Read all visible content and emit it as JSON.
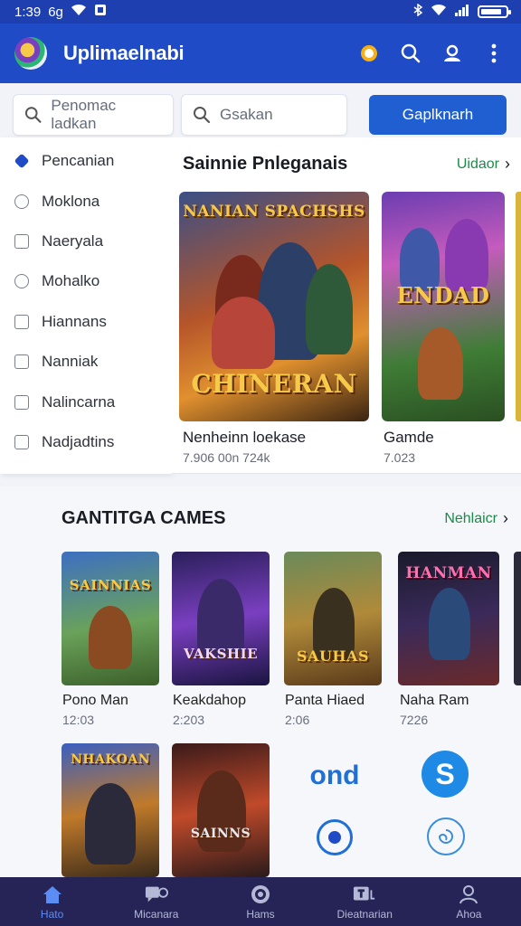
{
  "status_bar": {
    "time": "1:39",
    "extra": "6g"
  },
  "app_bar": {
    "title": "Uplimaelnabi"
  },
  "search": {
    "field1_placeholder": "Penomac ladkan",
    "field2_placeholder": "Gsakan",
    "button_label": "Gaplknarh"
  },
  "side_menu": {
    "items": [
      {
        "label": "Pencanian",
        "icon": "diamond-icon"
      },
      {
        "label": "Moklona",
        "icon": "tag-icon"
      },
      {
        "label": "Naeryala",
        "icon": "box-icon"
      },
      {
        "label": "Mohalko",
        "icon": "emoji-icon"
      },
      {
        "label": "Hiannans",
        "icon": "square-icon"
      },
      {
        "label": "Nanniak",
        "icon": "square-icon"
      },
      {
        "label": "Nalincarna",
        "icon": "square-icon"
      },
      {
        "label": "Nadjadtins",
        "icon": "square-icon"
      }
    ]
  },
  "featured": {
    "title": "Sainnie Pnleganais",
    "link": "Uidaor",
    "cards": [
      {
        "cover_title_top": "NANIAN SPACHSHS",
        "cover_title": "CHINERAN",
        "name": "Nenheinn loekase",
        "meta": "7.906 00n 724k"
      },
      {
        "cover_title": "ENDAD",
        "name": "Gamde",
        "meta": "7.023"
      }
    ]
  },
  "popular": {
    "title": "GANTITGA CAMES",
    "link": "Nehlaicr",
    "games": [
      {
        "cover": "SAINNIAS",
        "name": "Pono Man",
        "meta": "12:03"
      },
      {
        "cover": "VAKSHIE",
        "name": "Keakdahop",
        "meta": "2:203"
      },
      {
        "cover": "SAUHAS",
        "name": "Panta Hiaed",
        "meta": "2:06"
      },
      {
        "cover": "HANMAN",
        "name": "Naha Ram",
        "meta": "7226"
      },
      {
        "cover": "NHAKOAN",
        "name": "",
        "meta": ""
      },
      {
        "cover": "SAINNS",
        "name": "",
        "meta": ""
      }
    ],
    "brand_text": "ond"
  },
  "bottom_nav": {
    "items": [
      {
        "label": "Hato",
        "icon": "home-icon",
        "active": true
      },
      {
        "label": "Micanara",
        "icon": "chat-icon",
        "active": false
      },
      {
        "label": "Hams",
        "icon": "circle-icon",
        "active": false
      },
      {
        "label": "Dieatnarian",
        "icon": "tv-icon",
        "active": false
      },
      {
        "label": "Ahoa",
        "icon": "profile-icon",
        "active": false
      }
    ]
  },
  "colors": {
    "primary": "#1f4cc6",
    "nav": "#262457",
    "accent_link": "#1d8a4a"
  }
}
